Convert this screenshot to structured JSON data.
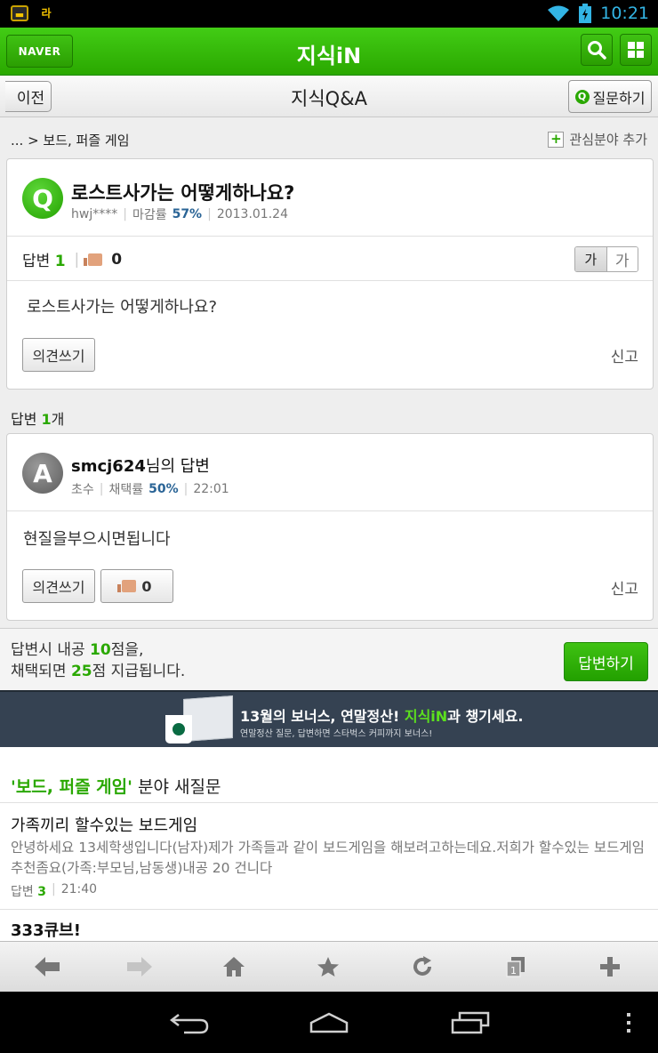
{
  "status_bar": {
    "time": "10:21",
    "app_badge": "라"
  },
  "header": {
    "naver_label": "NAVER",
    "title": "지식iN"
  },
  "subheader": {
    "back_label": "이전",
    "title": "지식Q&A",
    "ask_label": "질문하기"
  },
  "breadcrumb": {
    "path": "... > 보드, 퍼즐 게임",
    "interest_label": "관심분야 추가"
  },
  "question": {
    "title": "로스트사가는 어떻게하나요?",
    "author": "hwj****",
    "close_rate_label": "마감률",
    "close_rate": "57%",
    "date": "2013.01.24",
    "answers_label": "답변",
    "answers_count": "1",
    "likes": "0",
    "font_small": "가",
    "font_large": "가",
    "body": "로스트사가는 어떻게하나요?",
    "comment_label": "의견쓰기",
    "report_label": "신고"
  },
  "answers_section": {
    "prefix": "답변 ",
    "count": "1",
    "suffix": "개"
  },
  "answer": {
    "user": "smcj624",
    "title_suffix": "님의 답변",
    "level": "초수",
    "adopt_rate_label": "채택률",
    "adopt_rate": "50%",
    "time": "22:01",
    "body": "현질을부으시면됩니다",
    "comment_label": "의견쓰기",
    "likes": "0",
    "report_label": "신고"
  },
  "reward": {
    "line1_prefix": "답변시 내공 ",
    "line1_points": "10",
    "line1_suffix": "점을,",
    "line2_prefix": "채택되면 ",
    "line2_points": "25",
    "line2_suffix": "점 지급됩니다.",
    "button_label": "답변하기"
  },
  "banner": {
    "title_prefix": "13월의 보너스, 연말정산! ",
    "title_brand": "지식iN",
    "title_suffix": "과 챙기세요.",
    "subtitle": "연말정산 질문, 답변하면 스타벅스 커피까지 보너스!"
  },
  "new_questions": {
    "heading_category": "'보드, 퍼즐 게임'",
    "heading_suffix": " 분야 새질문",
    "items": [
      {
        "title": "가족끼리 할수있는 보드게임",
        "desc": "안녕하세요 13세학생입니다(남자)제가 가족들과 같이 보드게임을 해보려고하는데요.저희가 할수있는 보드게임 추천좀요(가족:부모님,남동생)내공 20 건니다",
        "answers_label": "답변",
        "answers_count": "3",
        "time": "21:40"
      },
      {
        "title": "333큐브!"
      }
    ]
  },
  "colors": {
    "naver_green": "#2aa800",
    "banner_bg": "#354252",
    "status_blue": "#33b5e5"
  }
}
